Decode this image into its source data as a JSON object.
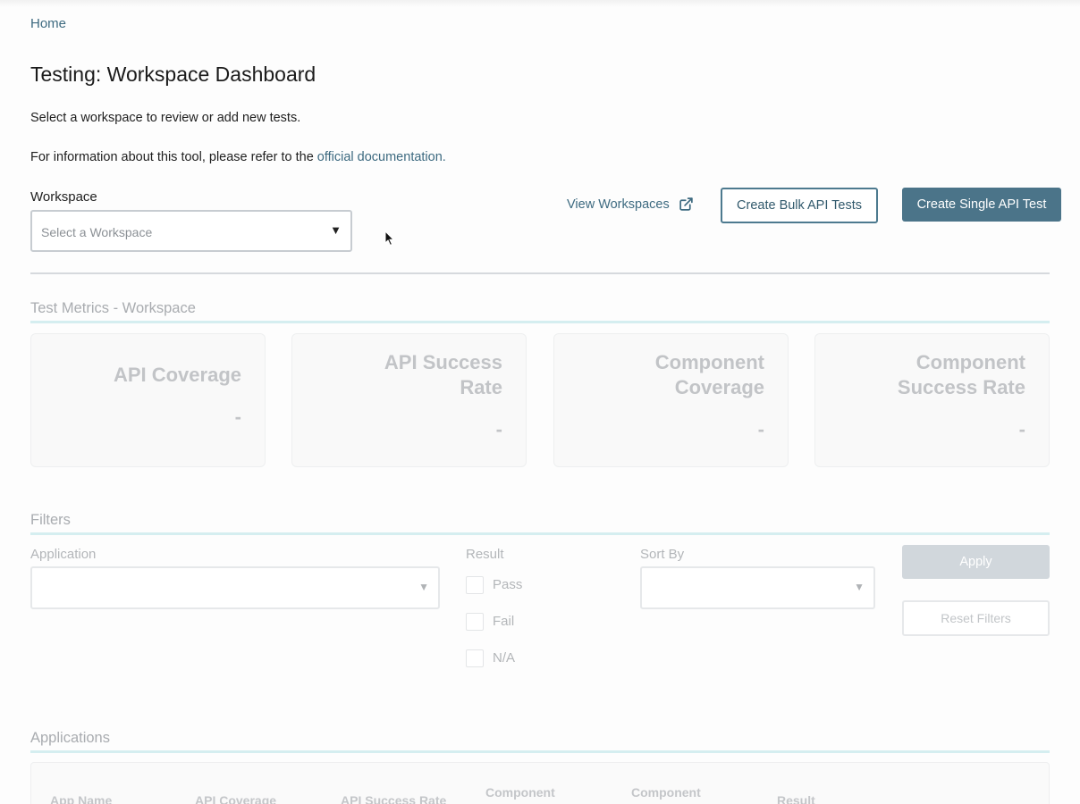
{
  "breadcrumb": {
    "home": "Home"
  },
  "page": {
    "title": "Testing: Workspace Dashboard",
    "intro": "Select a workspace to review or add new tests.",
    "info_prefix": "For information about this tool, please refer to the",
    "info_link": "official documentation."
  },
  "workspace": {
    "label": "Workspace",
    "placeholder": "Select a Workspace",
    "view_link": "View Workspaces",
    "bulk_button": "Create Bulk API Tests",
    "single_button": "Create Single API Test"
  },
  "metrics": {
    "title": "Test Metrics - Workspace",
    "cards": [
      {
        "title": "API Coverage",
        "value": "-"
      },
      {
        "title": "API Success Rate",
        "value": "-"
      },
      {
        "title": "Component Coverage",
        "value": "-"
      },
      {
        "title": "Component Success Rate",
        "value": "-"
      }
    ]
  },
  "filters": {
    "title": "Filters",
    "application_label": "Application",
    "result_label": "Result",
    "result_options": [
      "Pass",
      "Fail",
      "N/A"
    ],
    "sort_label": "Sort By",
    "apply_button": "Apply",
    "reset_button": "Reset Filters"
  },
  "applications": {
    "title": "Applications",
    "columns": [
      "App Name",
      "API Coverage",
      "API Success Rate",
      "Component",
      "Component",
      "Result"
    ]
  },
  "colors": {
    "accent": "#4b7489",
    "link": "#3d6a80",
    "section_line": "#d5eef0"
  }
}
